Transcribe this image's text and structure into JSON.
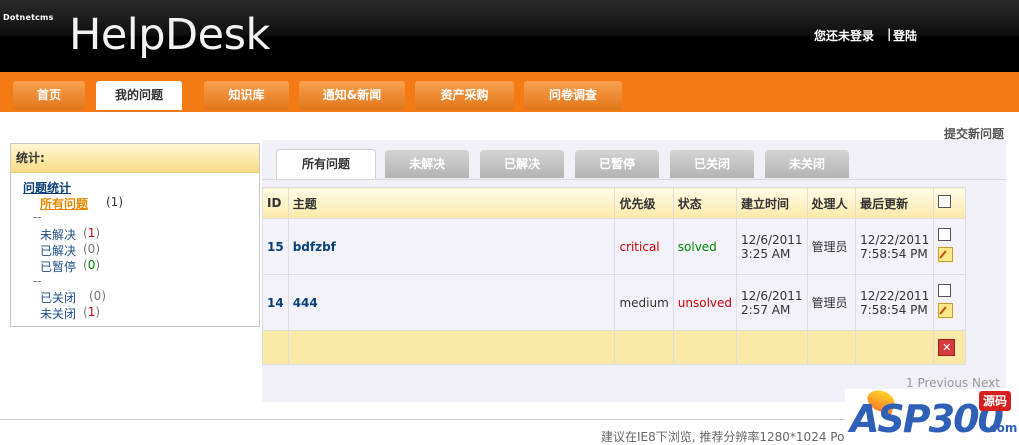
{
  "header": {
    "small_brand": "Dotnetcms",
    "logo": "HelpDesk",
    "login_status": "您还未登录",
    "separator": "|",
    "login_link": "登陆"
  },
  "nav": {
    "tabs": [
      {
        "label": "首页",
        "active": false
      },
      {
        "label": "我的问题",
        "active": true
      },
      {
        "label": "知识库",
        "active": false
      },
      {
        "label": "通知&新闻",
        "active": false
      },
      {
        "label": "资产采购",
        "active": false
      },
      {
        "label": "问卷调查",
        "active": false
      }
    ]
  },
  "submit_link": "提交新问题",
  "stats": {
    "header": "统计:",
    "group_title": "问题统计",
    "all": {
      "label": "所有问题",
      "count": "(1)"
    },
    "sep1": "--",
    "unsolved": {
      "label": "未解决",
      "count_open": "(",
      "count_num": "1",
      "count_close": ")"
    },
    "solved": {
      "label": "已解决",
      "count": "(0)"
    },
    "paused": {
      "label": "已暂停",
      "count_open": "(",
      "count_num": "0",
      "count_close": ")"
    },
    "sep2": "--",
    "closed": {
      "label": "已关闭",
      "count": "(0)"
    },
    "not_closed": {
      "label": "未关闭",
      "count_open": "(",
      "count_num": "1",
      "count_close": ")"
    }
  },
  "subtabs": [
    {
      "label": "所有问题",
      "active": true
    },
    {
      "label": "未解决",
      "active": false
    },
    {
      "label": "已解决",
      "active": false
    },
    {
      "label": "已暂停",
      "active": false
    },
    {
      "label": "已关闭",
      "active": false
    },
    {
      "label": "未关闭",
      "active": false
    }
  ],
  "table": {
    "headers": [
      "ID",
      "主题",
      "优先级",
      "状态",
      "建立时间",
      "处理人",
      "最后更新"
    ],
    "rows": [
      {
        "id": "15",
        "subject": "bdfzbf",
        "priority": "critical",
        "status": "solved",
        "created_date": "12/6/2011",
        "created_time": "3:25 AM",
        "handler": "管理员",
        "updated_date": "12/22/2011",
        "updated_time": "7:58:54 PM"
      },
      {
        "id": "14",
        "subject": "444",
        "priority": "medium",
        "status": "unsolved",
        "created_date": "12/6/2011",
        "created_time": "2:57 AM",
        "handler": "管理员",
        "updated_date": "12/22/2011",
        "updated_time": "7:58:54 PM"
      }
    ]
  },
  "pager": {
    "page": "1",
    "previous": "Previous",
    "next": "Next"
  },
  "footer_note": "建议在IE8下浏览, 推荐分辨率1280*1024 Pow",
  "watermark": {
    "main": "ASP300",
    "badge": "源码",
    "domain": ".com"
  },
  "icons": [
    "edit-icon",
    "delete-icon",
    "checkbox"
  ],
  "colors": {
    "nav": "#f47a14",
    "header": "#000000",
    "accent_link": "#0b3f78",
    "critical": "#cc0000",
    "solved": "#008800"
  }
}
